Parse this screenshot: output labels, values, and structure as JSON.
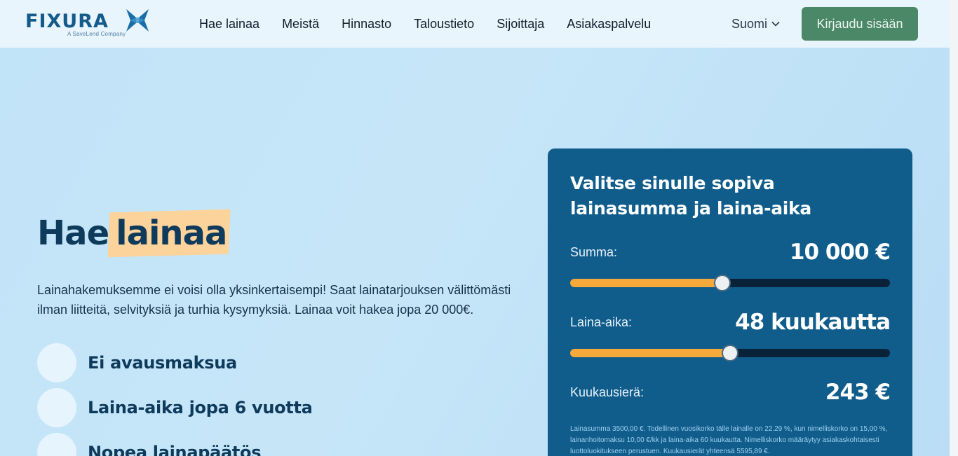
{
  "header": {
    "logo_text": "FIXURA",
    "logo_subtext": "A SaveLend Company",
    "nav": [
      "Hae lainaa",
      "Meistä",
      "Hinnasto",
      "Taloustieto",
      "Sijoittaja",
      "Asiakaspalvelu"
    ],
    "language": "Suomi",
    "login_label": "Kirjaudu sisään"
  },
  "hero": {
    "title_part1": "Hae",
    "title_highlight": "lainaa",
    "text": "Lainahakemuksemme ei voisi olla yksinkertaisempi! Saat lainatarjouksen välittömästi ilman liitteitä, selvityksiä ja turhia kysymyksiä. Lainaa voit hakea jopa 20 000€.",
    "features": [
      "Ei avausmaksua",
      "Laina-aika jopa 6 vuotta",
      "Nopea lainapäätös"
    ]
  },
  "calculator": {
    "title": "Valitse sinulle sopiva lainasumma ja laina-aika",
    "amount_label": "Summa:",
    "amount_value": "10 000 €",
    "amount_fraction": 0.475,
    "term_label": "Laina-aika:",
    "term_value": "48 kuukautta",
    "term_fraction": 0.5,
    "monthly_label": "Kuukausierä:",
    "monthly_value": "243 €",
    "disclaimer": "Lainasumma 3500,00 €. Todellinen vuosikorko tälle lainalle on 22.29 %, kun nimelliskorko on 15,00 %, lainanhoitomaksu 10,00 €/kk ja laina-aika 60 kuukautta. Nimelliskorko määräytyy asiakaskohtaisesti luottoluokitukseen perustuen. Kuukausierät yhteensä 5595,89 €."
  },
  "colors": {
    "accent_orange": "#f6a93b",
    "panel_blue": "#105d8c",
    "login_green": "#4a8868",
    "highlight": "#fbd39b"
  }
}
